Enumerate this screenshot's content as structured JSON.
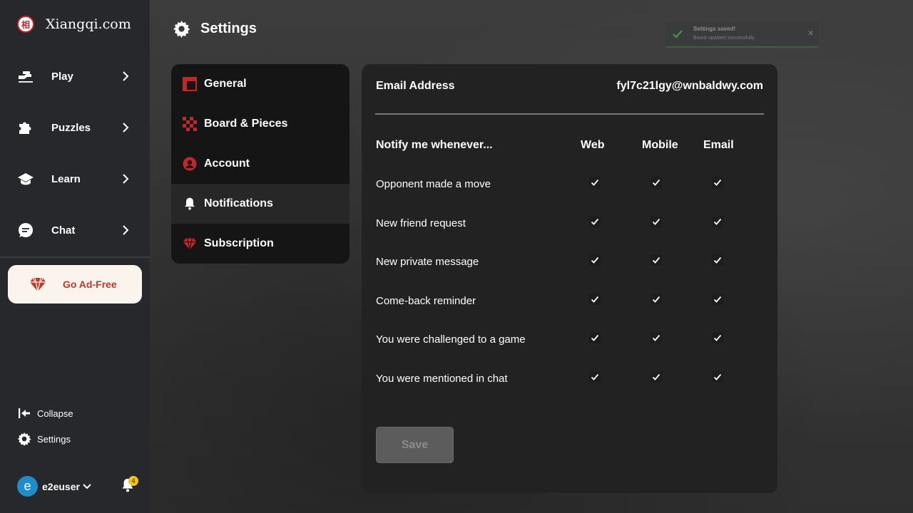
{
  "brand": {
    "name": "Xiangqi.com",
    "logo_glyph": "相"
  },
  "sidebar": {
    "items": [
      {
        "label": "Play",
        "icon": "play-hand-icon"
      },
      {
        "label": "Puzzles",
        "icon": "puzzle-icon"
      },
      {
        "label": "Learn",
        "icon": "graduation-cap-icon"
      },
      {
        "label": "Chat",
        "icon": "chat-bubble-icon"
      }
    ],
    "go_adfree": "Go Ad-Free",
    "collapse": "Collapse",
    "settings": "Settings",
    "user": {
      "initial": "e",
      "name": "e2euser"
    },
    "notification_count": "4"
  },
  "header": {
    "title": "Settings"
  },
  "toast": {
    "title": "Settings saved!",
    "message": "Board updated successfully"
  },
  "settings_menu": [
    {
      "label": "General",
      "icon": "layout-icon"
    },
    {
      "label": "Board & Pieces",
      "icon": "checkerboard-icon"
    },
    {
      "label": "Account",
      "icon": "user-circle-icon"
    },
    {
      "label": "Notifications",
      "icon": "bell-icon",
      "active": true
    },
    {
      "label": "Subscription",
      "icon": "gem-icon"
    }
  ],
  "notifications": {
    "email_label": "Email Address",
    "email_value": "fyl7c21lgy@wnbaldwy.com",
    "heading": "Notify me whenever...",
    "columns": [
      "Web",
      "Mobile",
      "Email"
    ],
    "rows": [
      {
        "label": "Opponent made a move",
        "web": true,
        "mobile": true,
        "email": true
      },
      {
        "label": "New friend request",
        "web": true,
        "mobile": true,
        "email": true
      },
      {
        "label": "New private message",
        "web": true,
        "mobile": true,
        "email": true
      },
      {
        "label": "Come-back reminder",
        "web": true,
        "mobile": true,
        "email": true
      },
      {
        "label": "You were challenged to a game",
        "web": true,
        "mobile": true,
        "email": true
      },
      {
        "label": "You were mentioned in chat",
        "web": true,
        "mobile": true,
        "email": true
      }
    ],
    "save_label": "Save"
  },
  "colors": {
    "accent": "#c0282a",
    "sidebar_bg": "#26282b",
    "panel_bg": "#222222",
    "badge": "#f0c419",
    "avatar": "#1f8ec8"
  }
}
